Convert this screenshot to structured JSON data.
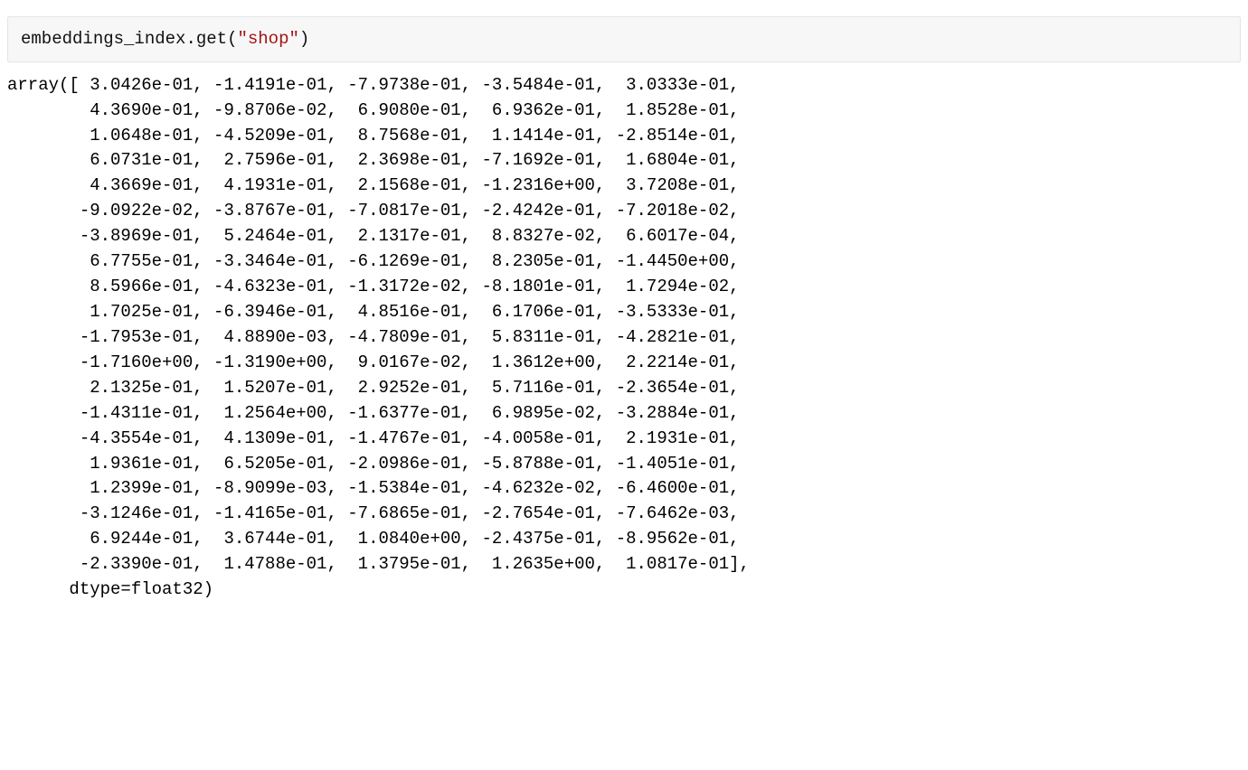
{
  "code": {
    "object": "embeddings_index",
    "method": "get",
    "arg": "\"shop\"",
    "full": "embeddings_index.get(\"shop\")"
  },
  "output": {
    "prefix": "array([",
    "dtype_line": "      dtype=float32)",
    "rows": [
      " 3.0426e-01, -1.4191e-01, -7.9738e-01, -3.5484e-01,  3.0333e-01,",
      " 4.3690e-01, -9.8706e-02,  6.9080e-01,  6.9362e-01,  1.8528e-01,",
      " 1.0648e-01, -4.5209e-01,  8.7568e-01,  1.1414e-01, -2.8514e-01,",
      " 6.0731e-01,  2.7596e-01,  2.3698e-01, -7.1692e-01,  1.6804e-01,",
      " 4.3669e-01,  4.1931e-01,  2.1568e-01, -1.2316e+00,  3.7208e-01,",
      "-9.0922e-02, -3.8767e-01, -7.0817e-01, -2.4242e-01, -7.2018e-02,",
      "-3.8969e-01,  5.2464e-01,  2.1317e-01,  8.8327e-02,  6.6017e-04,",
      " 6.7755e-01, -3.3464e-01, -6.1269e-01,  8.2305e-01, -1.4450e+00,",
      " 8.5966e-01, -4.6323e-01, -1.3172e-02, -8.1801e-01,  1.7294e-02,",
      " 1.7025e-01, -6.3946e-01,  4.8516e-01,  6.1706e-01, -3.5333e-01,",
      "-1.7953e-01,  4.8890e-03, -4.7809e-01,  5.8311e-01, -4.2821e-01,",
      "-1.7160e+00, -1.3190e+00,  9.0167e-02,  1.3612e+00,  2.2214e-01,",
      " 2.1325e-01,  1.5207e-01,  2.9252e-01,  5.7116e-01, -2.3654e-01,",
      "-1.4311e-01,  1.2564e+00, -1.6377e-01,  6.9895e-02, -3.2884e-01,",
      "-4.3554e-01,  4.1309e-01, -1.4767e-01, -4.0058e-01,  2.1931e-01,",
      " 1.9361e-01,  6.5205e-01, -2.0986e-01, -5.8788e-01, -1.4051e-01,",
      " 1.2399e-01, -8.9099e-03, -1.5384e-01, -4.6232e-02, -6.4600e-01,",
      "-3.1246e-01, -1.4165e-01, -7.6865e-01, -2.7654e-01, -7.6462e-03,",
      " 6.9244e-01,  3.6744e-01,  1.0840e+00, -2.4375e-01, -8.9562e-01,",
      "-2.3390e-01,  1.4788e-01,  1.3795e-01,  1.2635e+00,  1.0817e-01],"
    ]
  }
}
